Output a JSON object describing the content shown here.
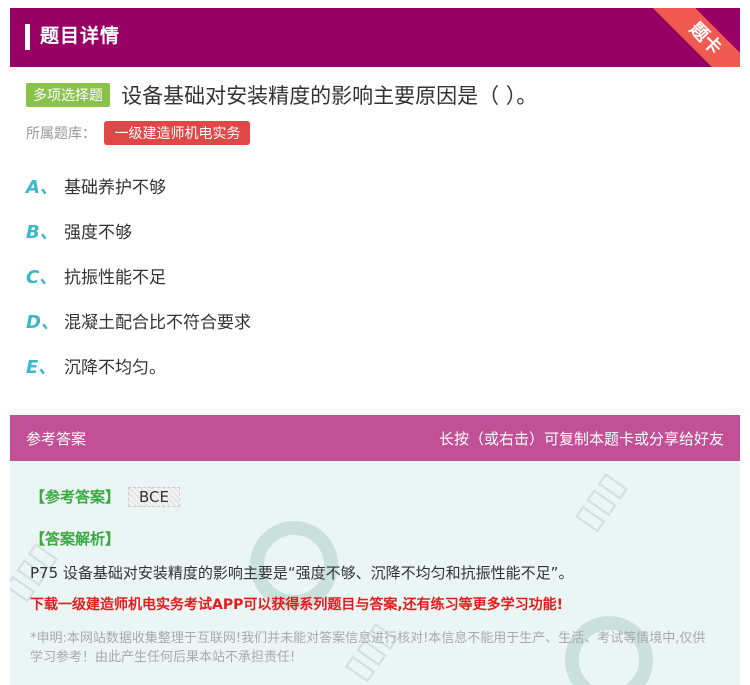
{
  "header": {
    "title": "题目详情",
    "ribbon": "题卡"
  },
  "question": {
    "type_tag": "多项选择题",
    "text": "设备基础对安装精度的影响主要原因是（    ）。",
    "bank_label": "所属题库：",
    "bank_name": "一级建造师机电实务"
  },
  "options": [
    {
      "letter": "A、",
      "text": "基础养护不够"
    },
    {
      "letter": "B、",
      "text": "强度不够"
    },
    {
      "letter": "C、",
      "text": "抗振性能不足"
    },
    {
      "letter": "D、",
      "text": "混凝土配合比不符合要求"
    },
    {
      "letter": "E、",
      "text": "沉降不均匀。"
    }
  ],
  "answer": {
    "section_label": "参考答案",
    "hint": "长按（或右击）可复制本题卡或分享给好友",
    "answer_tag": "【参考答案】",
    "answer_value": "BCE",
    "analysis_tag": "【答案解析】",
    "analysis_text": "P75 设备基础对安装精度的影响主要是“强度不够、沉降不均匀和抗振性能不足”。",
    "promo": "下载一级建造师机电实务考试APP可以获得系列题目与答案,还有练习等更多学习功能!",
    "disclaimer": "*申明:本网站数据收集整理于互联网!我们并未能对答案信息进行核对!本信息不能用于生产、生活、考试等情境中,仅供学习参考！由此产生任何后果本站不承担责任!"
  },
  "colors": {
    "header_bg": "#990066",
    "ribbon": "#f05a50",
    "type_tag": "#8bc34a",
    "bank_tag": "#e04848",
    "option_letter": "#3cb8c8",
    "answer_header": "#c25096",
    "answer_body": "#ebf5f3"
  }
}
